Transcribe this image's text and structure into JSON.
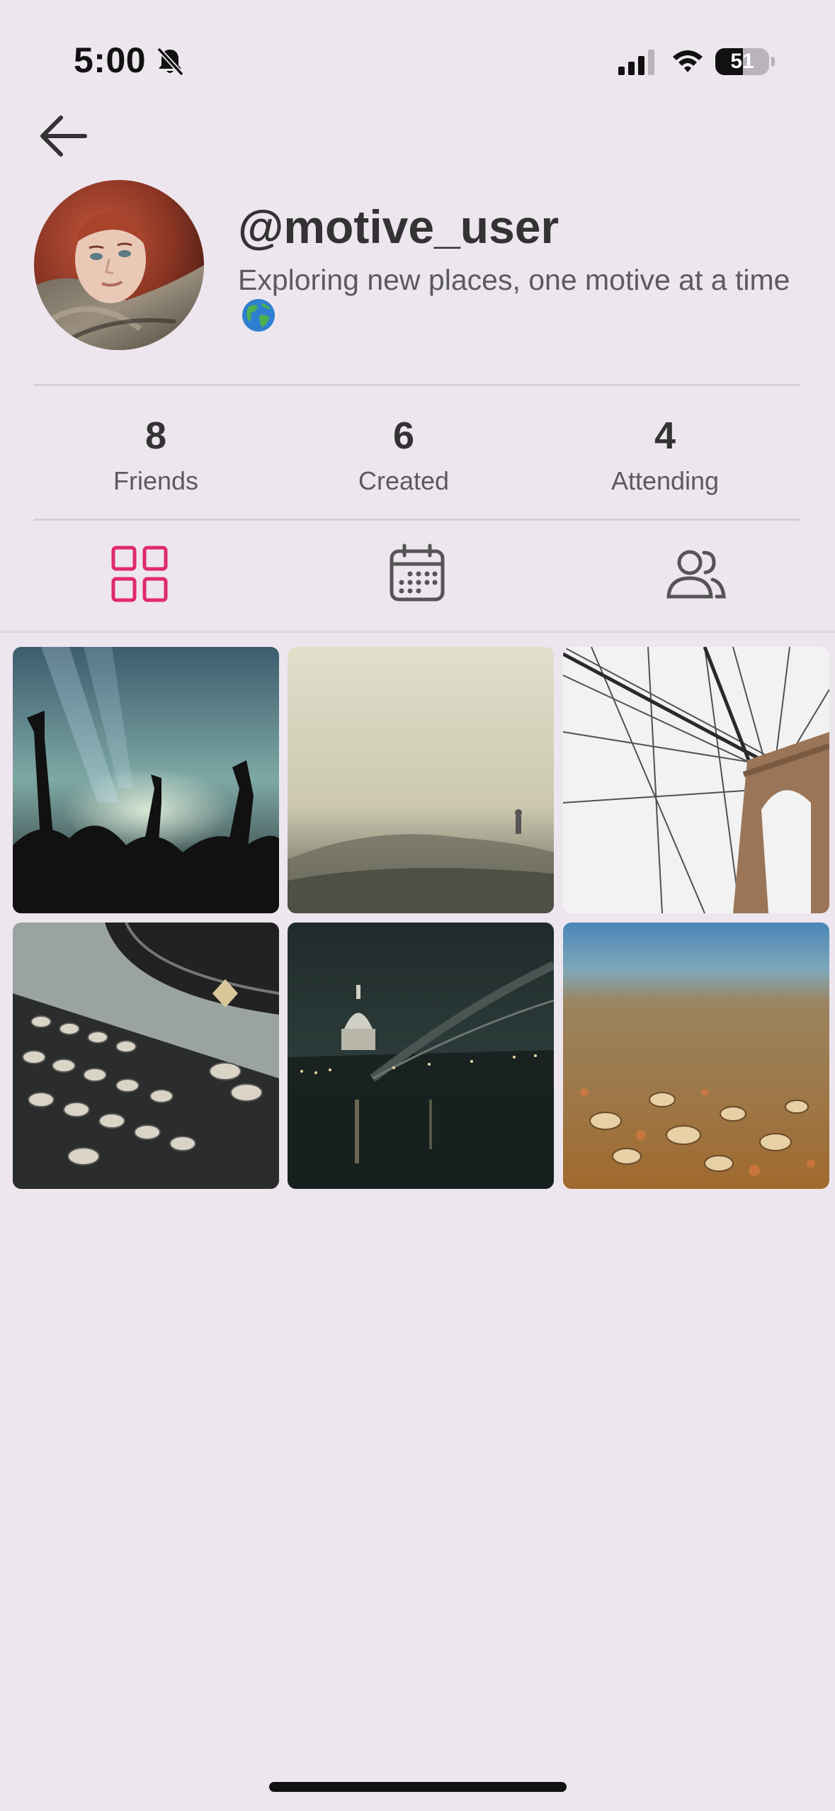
{
  "status_bar": {
    "time": "5:00",
    "battery": "51",
    "battery_level": 0.51,
    "icons": [
      "bell-muted-icon",
      "cellular-signal-icon",
      "wifi-icon",
      "battery-icon"
    ]
  },
  "profile": {
    "username": "@motive_user",
    "bio": "Exploring new places, one motive at a time"
  },
  "stats": [
    {
      "value": "8",
      "label": "Friends"
    },
    {
      "value": "6",
      "label": "Created"
    },
    {
      "value": "4",
      "label": "Attending"
    }
  ],
  "tabs": [
    {
      "icon": "grid-icon",
      "active": true
    },
    {
      "icon": "calendar-icon",
      "active": false
    },
    {
      "icon": "friends-icon",
      "active": false
    }
  ],
  "colors": {
    "background": "#ede6ee",
    "accent": "#e02a6c",
    "text": "#3a3a3c",
    "muted": "#5b5b5f"
  },
  "grid": [
    {
      "subject": "concert-crowd"
    },
    {
      "subject": "foggy-hill-figure"
    },
    {
      "subject": "bridge-cables"
    },
    {
      "subject": "typewriter"
    },
    {
      "subject": "city-night-river"
    },
    {
      "subject": "beach-shells"
    }
  ]
}
